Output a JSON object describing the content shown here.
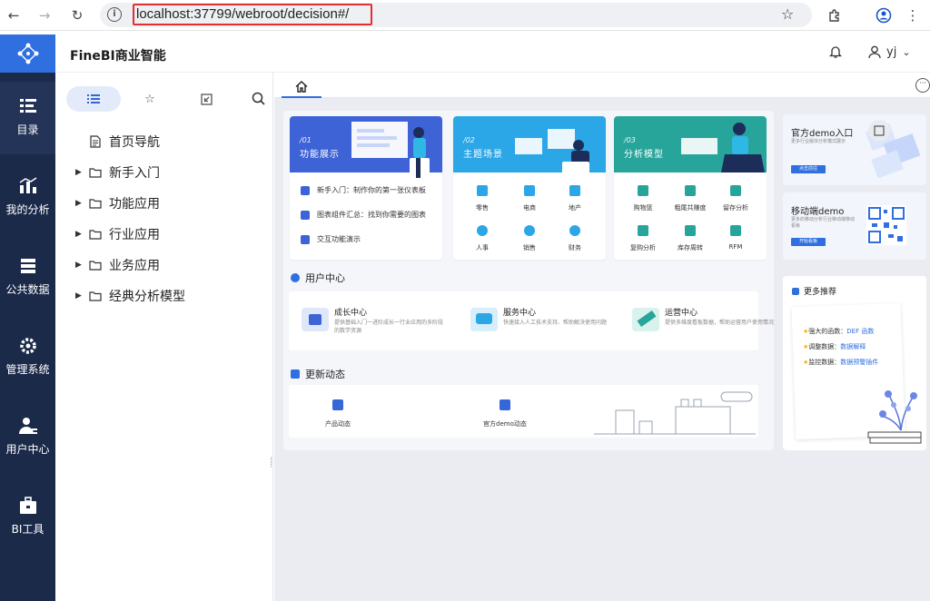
{
  "browser": {
    "url": "localhost:37799/webroot/decision#/"
  },
  "app": {
    "title": "FineBI商业智能",
    "user": "yj"
  },
  "rail": {
    "items": [
      {
        "label": "目录",
        "icon": "catalog-icon"
      },
      {
        "label": "我的分析",
        "icon": "analysis-icon"
      },
      {
        "label": "公共数据",
        "icon": "database-icon"
      },
      {
        "label": "管理系统",
        "icon": "settings-icon"
      },
      {
        "label": "用户中心",
        "icon": "user-icon"
      },
      {
        "label": "BI工具",
        "icon": "toolbox-icon"
      }
    ]
  },
  "tree": {
    "items": [
      {
        "label": "首页导航",
        "type": "doc"
      },
      {
        "label": "新手入门",
        "type": "folder"
      },
      {
        "label": "功能应用",
        "type": "folder"
      },
      {
        "label": "行业应用",
        "type": "folder"
      },
      {
        "label": "业务应用",
        "type": "folder"
      },
      {
        "label": "经典分析模型",
        "type": "folder"
      }
    ]
  },
  "home": {
    "cards": [
      {
        "no": "/01",
        "title": "功能展示",
        "color": "#3e63d6"
      },
      {
        "no": "/02",
        "title": "主题场景",
        "color": "#2ba6e6"
      },
      {
        "no": "/03",
        "title": "分析模型",
        "color": "#27a59a"
      }
    ],
    "card1_rows": [
      "新手入门：制作你的第一张仪表板",
      "图表组件汇总：找到你需要的图表",
      "交互功能演示"
    ],
    "card2_grid": [
      "零售",
      "电商",
      "地产",
      "人事",
      "销售",
      "财务"
    ],
    "card3_grid": [
      "购物篮",
      "粗尾共赚度",
      "留存分析",
      "复购分析",
      "库存周转",
      "RFM"
    ],
    "user_center_title": "用户中心",
    "user_center": [
      {
        "title": "成长中心",
        "desc": "提供基础入门一进阶成长一行业应用的多阶段的数学资源"
      },
      {
        "title": "服务中心",
        "desc": "快速接入人工技术支持、帮助解决使用问题"
      },
      {
        "title": "运营中心",
        "desc": "提供多维度看板数据，帮助运营用户使用情况"
      }
    ],
    "news_title": "更新动态",
    "news": [
      "产品动态",
      "官方demo动态"
    ],
    "side": {
      "demo_title": "官方demo入口",
      "demo_desc": "更多行业版块分析模式展示",
      "demo_btn": "点击前往",
      "mobile_title": "移动端demo",
      "mobile_desc": "更多的移动分析行业移动端移动看板",
      "mobile_btn": "开始看板",
      "more_title": "更多推荐",
      "more_rows": [
        {
          "label": "强大的函数：",
          "link": "DEF 函数"
        },
        {
          "label": "调整数据：",
          "link": "数据解释"
        },
        {
          "label": "监控数据：",
          "link": "数据预警插件"
        }
      ]
    }
  }
}
